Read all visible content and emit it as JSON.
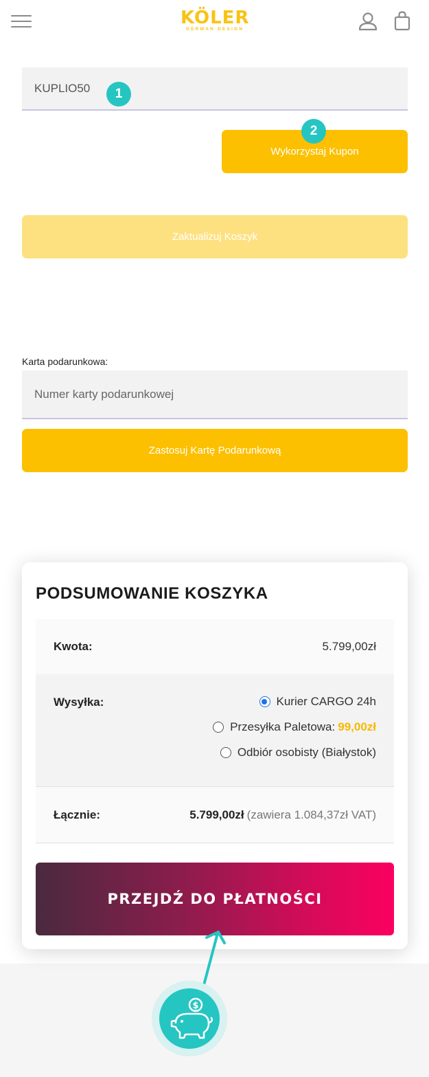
{
  "header": {
    "logo_main": "KÖLER",
    "logo_sub": "GERMAN DESIGN",
    "menu_icon": "hamburger-menu-icon",
    "account_icon": "user-icon",
    "cart_icon": "shopping-bag-icon"
  },
  "coupon": {
    "value": "KUPLIO50",
    "apply_label": "Wykorzystaj Kupon",
    "update_label": "Zaktualizuj Koszyk"
  },
  "markers": {
    "first": "1",
    "second": "2"
  },
  "gift_card": {
    "label": "Karta podarunkowa:",
    "placeholder": "Numer karty podarunkowej",
    "apply_label": "Zastosuj Kartę Podarunkową"
  },
  "summary": {
    "title": "PODSUMOWANIE KOSZYKA",
    "amount_label": "Kwota:",
    "amount_value": "5.799,00zł",
    "shipping_label": "Wysyłka:",
    "shipping_options": [
      {
        "label": "Kurier CARGO 24h",
        "price": "",
        "selected": true
      },
      {
        "label": "Przesyłka Paletowa:",
        "price": "99,00zł",
        "selected": false
      },
      {
        "label": "Odbiór osobisty (Białystok)",
        "price": "",
        "selected": false
      }
    ],
    "total_label": "Łącznie:",
    "total_value": "5.799,00zł",
    "total_vat": "(zawiera 1.084,37zł VAT)",
    "pay_label": "PRZEJDŹ DO PŁATNOŚCI"
  },
  "decor": {
    "arrow_icon": "arrow-up-icon",
    "piggy_icon": "piggy-bank-icon",
    "coin_symbol": "$"
  },
  "colors": {
    "brand_yellow": "#fcc000",
    "brand_yellow_light": "#fde180",
    "marker_teal": "#25c5c2",
    "pay_gradient_start": "#4a2a3e",
    "pay_gradient_end": "#fb0060",
    "price_highlight": "#f6b900",
    "radio_blue": "#1a73e8"
  }
}
